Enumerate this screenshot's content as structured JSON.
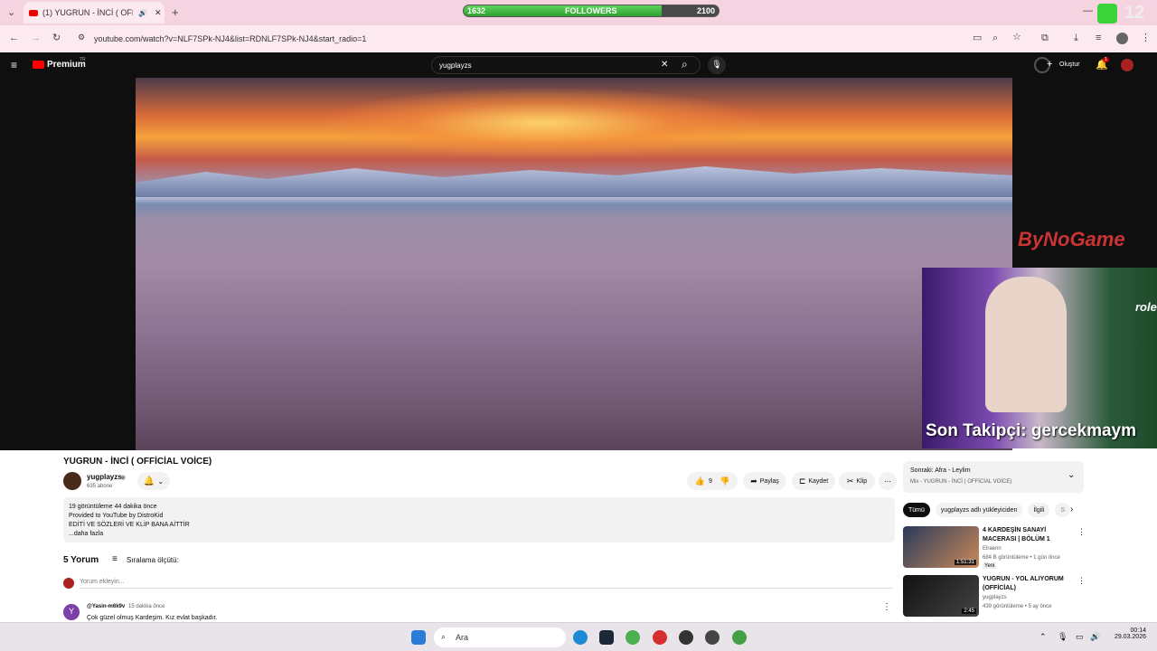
{
  "browser": {
    "tab_title": "(1) YUGRUN - İNCİ ( OFFICİ",
    "url": "youtube.com/watch?v=NLF7SPk-NJ4&list=RDNLF7SPk-NJ4&start_radio=1"
  },
  "followers_bar": {
    "label": "FOLLOWERS",
    "current": "1632",
    "goal": "2100",
    "progress": 0.777
  },
  "top_right_counter": "12",
  "youtube": {
    "logo": "Premium",
    "logo_sup": "TR",
    "search_value": "yugplayzs",
    "create_label": "Oluştur",
    "notif_count": "1"
  },
  "overlays": {
    "watermark": "ByNoGame",
    "last_follower": "Son Takipçi: gercekmaym",
    "cam_text": "role"
  },
  "video": {
    "title": "YUGRUN - İNCİ ( OFFİCİAL VOİCE)",
    "channel": "yugplayzs",
    "subscribers": "635 abone",
    "likes": "9",
    "share": "Paylaş",
    "save": "Kaydet",
    "clip": "Klip"
  },
  "description": {
    "meta": "19 görüntüleme  44 dakika önce",
    "line1": "Provided to YouTube by DistroKid",
    "line2": "EDİTİ VE SÖZLERİ VE KLİP BANA AİTTİR",
    "more": "...daha fazla"
  },
  "comments": {
    "count": "5 Yorum",
    "sort": "Sıralama ölçütü:",
    "add_placeholder": "Yorum ekleyin...",
    "first": {
      "avatar": "Y",
      "author": "@Yasin-m6k9v",
      "time": "15 dakika önce",
      "text": "Çok güzel olmuş Kardeşim. Kız evlat başkadır."
    }
  },
  "up_next": {
    "label": "Sonraki: Afra - Leylim",
    "sub": "Mix - YUGRUN - İNCİ ( OFFİCİAL VOİCE)"
  },
  "chips": [
    "Tümü",
    "yugplayzs adlı yükleyiciden",
    "İlgili",
    "S"
  ],
  "recommendations": [
    {
      "title": "4 KARDEŞİN SANAYİ MACERASI | BÖLÜM 1",
      "channel": "Elraenn",
      "meta": "684 B görüntüleme • 1 gün önce",
      "badge": "Yeni",
      "duration": "1:51:31"
    },
    {
      "title": "YUGRUN - YOL ALIYORUM (OFFİCİAL)",
      "channel": "yugplayzs",
      "meta": "439 görüntüleme • 5 ay önce",
      "badge": "",
      "duration": "2:45"
    }
  ],
  "taskbar": {
    "search": "Ara",
    "time": "00:14",
    "date": "29.03.2026"
  }
}
